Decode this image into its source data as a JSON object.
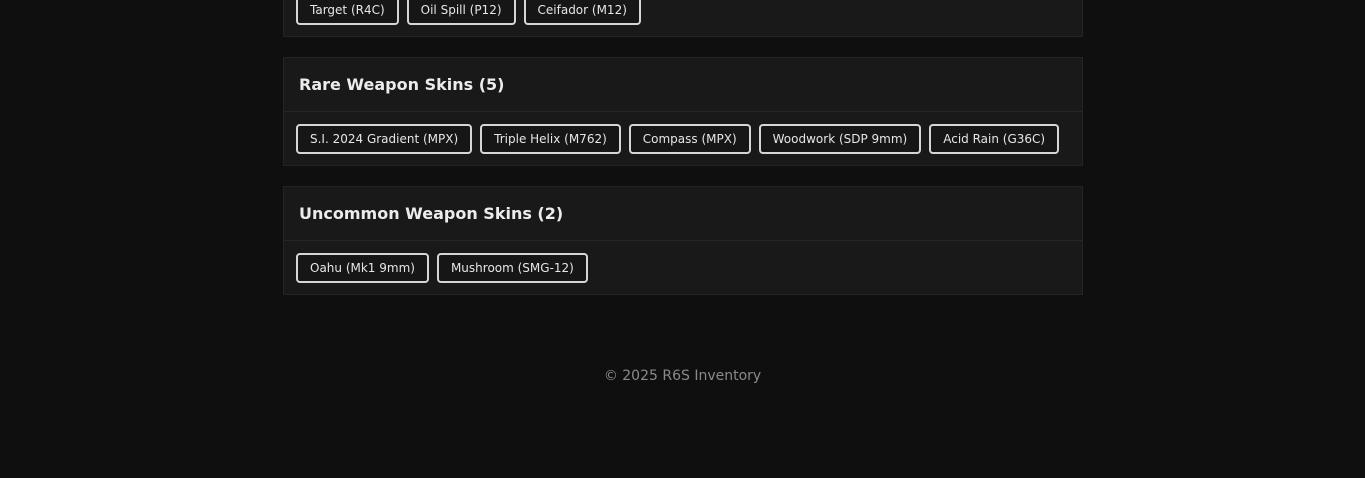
{
  "sections": [
    {
      "title": "",
      "items": [
        "Target (R4C)",
        "Oil Spill (P12)",
        "Ceifador (M12)"
      ]
    },
    {
      "title": "Rare Weapon Skins (5)",
      "items": [
        "S.I. 2024 Gradient (MPX)",
        "Triple Helix (M762)",
        "Compass (MPX)",
        "Woodwork (SDP 9mm)",
        "Acid Rain (G36C)"
      ]
    },
    {
      "title": "Uncommon Weapon Skins (2)",
      "items": [
        "Oahu (Mk1 9mm)",
        "Mushroom (SMG-12)"
      ]
    }
  ],
  "footer": {
    "text": "© 2025 R6S Inventory"
  }
}
